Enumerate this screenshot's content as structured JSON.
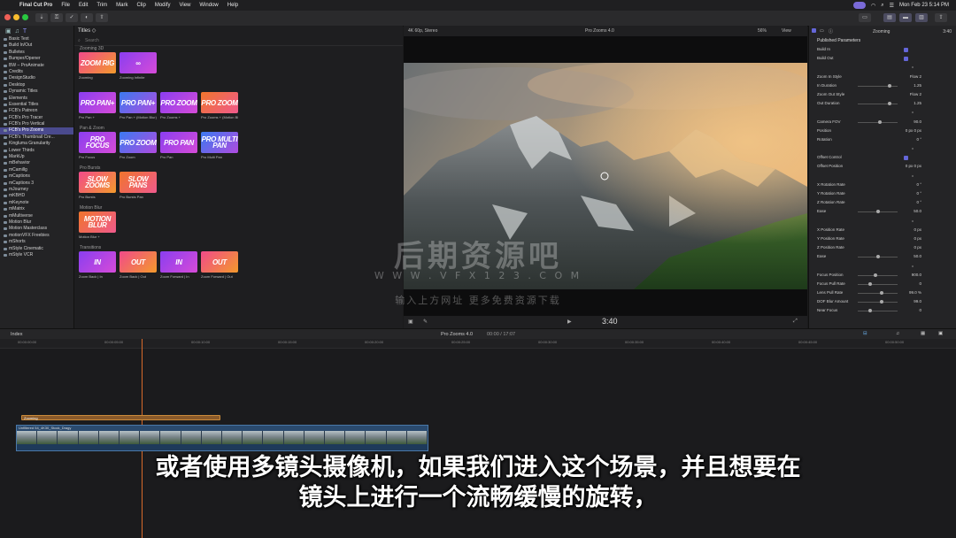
{
  "menubar": {
    "app": "Final Cut Pro",
    "items": [
      "File",
      "Edit",
      "Trim",
      "Mark",
      "Clip",
      "Modify",
      "View",
      "Window",
      "Help"
    ],
    "datetime": "Mon Feb 23  5:14 PM"
  },
  "sidebar": {
    "items": [
      {
        "label": "Basic Text"
      },
      {
        "label": "Build In/Out"
      },
      {
        "label": "Bulletes"
      },
      {
        "label": "Bumper/Opener"
      },
      {
        "label": "BW – ProAnimate"
      },
      {
        "label": "Credits"
      },
      {
        "label": "DesignStudio"
      },
      {
        "label": "Desktop"
      },
      {
        "label": "Dynamic Titles"
      },
      {
        "label": "Elements"
      },
      {
        "label": "Essential Titles"
      },
      {
        "label": "FCB's Patreon"
      },
      {
        "label": "FCB's Pro Tracer"
      },
      {
        "label": "FCB's Pro Vertical"
      },
      {
        "label": "FCB's Pro Zooms",
        "selected": true
      },
      {
        "label": "FCB's Thumbnail Cre..."
      },
      {
        "label": "Kingluma Granularity"
      },
      {
        "label": "Lower Thirds"
      },
      {
        "label": "MarkUp"
      },
      {
        "label": "mBehavior"
      },
      {
        "label": "mCamillg"
      },
      {
        "label": "mCaptions"
      },
      {
        "label": "mCaptions 3"
      },
      {
        "label": "mJourney"
      },
      {
        "label": "mKBHD"
      },
      {
        "label": "mKeynote"
      },
      {
        "label": "mMatrix"
      },
      {
        "label": "mMultiverse"
      },
      {
        "label": "Motion Blur"
      },
      {
        "label": "Motion Masterclass"
      },
      {
        "label": "motionVFX Freebies"
      },
      {
        "label": "mShorts"
      },
      {
        "label": "mStyle Cinematic"
      },
      {
        "label": "mStyle VCR"
      }
    ]
  },
  "browser": {
    "header": "Titles",
    "search_placeholder": "Search",
    "sections": [
      {
        "name": "Zooming 3D",
        "tiles": [
          {
            "art": "ZOOM RIG",
            "caption": "Zooming",
            "style": "g-or"
          },
          {
            "art": "∞",
            "caption": "Zooming Infinite",
            "style": "g-pu"
          }
        ]
      },
      {
        "name": "",
        "tiles": [
          {
            "art": "PRO PAN+",
            "caption": "Pro Pan +",
            "style": "g-pu"
          },
          {
            "art": "PRO PAN+",
            "caption": "Pro Pan + (Motion Blur)",
            "style": "g-bl"
          },
          {
            "art": "PRO ZOOM",
            "caption": "Pro Zooms +",
            "style": "g-pu"
          },
          {
            "art": "PRO ZOOM",
            "caption": "Pro Zooms + (Motion Blur)",
            "style": "g-or2"
          }
        ]
      },
      {
        "name": "Pan & Zoom",
        "tiles": [
          {
            "art": "PRO FOCUS",
            "caption": "Pro Focus",
            "style": "g-pu"
          },
          {
            "art": "PRO ZOOM",
            "caption": "Pro Zoom",
            "style": "g-bl"
          },
          {
            "art": "PRO PAN",
            "caption": "Pro Pan",
            "style": "g-pu"
          },
          {
            "art": "PRO MULTI PAN",
            "caption": "Pro Multi Pan",
            "style": "g-bl"
          }
        ]
      },
      {
        "name": "Pro Bursts",
        "tiles": [
          {
            "art": "SLOW ZOOMS",
            "caption": "Pro Bursts",
            "style": "g-or"
          },
          {
            "art": "SLOW PANS",
            "caption": "Pro Bursts Pan",
            "style": "g-or2"
          }
        ]
      },
      {
        "name": "Motion Blur",
        "tiles": [
          {
            "art": "MOTION BLUR",
            "caption": "Motion Blur +",
            "style": "g-or2"
          }
        ]
      },
      {
        "name": "Transitions",
        "tiles": [
          {
            "art": "IN",
            "caption": "Zoom Back | In",
            "style": "g-pu"
          },
          {
            "art": "OUT",
            "caption": "Zoom Back | Out",
            "style": "g-or"
          },
          {
            "art": "IN",
            "caption": "Zoom Forward | In",
            "style": "g-pu"
          },
          {
            "art": "OUT",
            "caption": "Zoom Forward | Out",
            "style": "g-or"
          }
        ]
      }
    ]
  },
  "viewer": {
    "format": "4K 60p, Stereo",
    "clip_name": "Pro Zooms 4.0",
    "zoom": "56%",
    "view_label": "View",
    "timecode": "3:40"
  },
  "inspector": {
    "title": "Zooming",
    "duration": "3:40",
    "section": "Published Parameters",
    "params": [
      {
        "label": "Build In",
        "type": "check"
      },
      {
        "label": "Build Out",
        "type": "check"
      },
      {
        "label": "",
        "type": "sep"
      },
      {
        "label": "Zoom In Style",
        "value": "Flow 2"
      },
      {
        "label": "In Duration",
        "value": "1.25",
        "slider": 0.8
      },
      {
        "label": "Zoom Out Style",
        "value": "Flow 2"
      },
      {
        "label": "Out Duration",
        "value": "1.25",
        "slider": 0.8
      },
      {
        "label": "",
        "type": "sep"
      },
      {
        "label": "Camera FOV",
        "value": "90.0",
        "slider": 0.55
      },
      {
        "label": "Position",
        "value": "0  px    0  px"
      },
      {
        "label": "Rotation",
        "value": "0 °"
      },
      {
        "label": "",
        "type": "sep"
      },
      {
        "label": "Offset Control",
        "type": "check"
      },
      {
        "label": "Offset Position",
        "value": "0  px    0  px"
      },
      {
        "label": "",
        "type": "sep"
      },
      {
        "label": "X Rotation Rate",
        "value": "0 °"
      },
      {
        "label": "Y Rotation Rate",
        "value": "0 °"
      },
      {
        "label": "Z Rotation Rate",
        "value": "0 °"
      },
      {
        "label": "Ease",
        "value": "50.0",
        "slider": 0.5
      },
      {
        "label": "",
        "type": "sep"
      },
      {
        "label": "X Position Rate",
        "value": "0  px"
      },
      {
        "label": "Y Position Rate",
        "value": "0  px"
      },
      {
        "label": "Z Position Rate",
        "value": "0  px"
      },
      {
        "label": "Ease",
        "value": "50.0",
        "slider": 0.5
      },
      {
        "label": "",
        "type": "sep"
      },
      {
        "label": "Focus Position",
        "value": "900.0",
        "slider": 0.45
      },
      {
        "label": "Focus Pull Rate",
        "value": "0",
        "slider": 0.3
      },
      {
        "label": "Lens Pull Rate",
        "value": "99.0  %",
        "slider": 0.6
      },
      {
        "label": "DOF Blur Amount",
        "value": "99.0",
        "slider": 0.6
      },
      {
        "label": "Near Focus",
        "value": "0",
        "slider": 0.3
      }
    ]
  },
  "timeline": {
    "index_label": "Index",
    "project_name": "Pro Zooms 4.0",
    "project_time": "00:00 / 17:07",
    "ruler": [
      "00:00:00:00",
      "00:00:05:00",
      "00:00:10:00",
      "00:00:15:00",
      "00:00:20:00",
      "00:00:25:00",
      "00:00:30:00",
      "00:00:35:00",
      "00:00:40:00",
      "00:00:45:00",
      "00:00:50:00",
      "00:00:55:00"
    ],
    "title_clip": "Zooming",
    "video_clip": "Unfiltered 54_4K30_Stock_Dragy"
  },
  "watermark": {
    "line1": "后期资源吧",
    "line2": "W W W . V F X 1 2 3 . C O M",
    "line3": "输入上方网址 更多免费资源下载"
  },
  "subtitle": {
    "line1": "或者使用多镜头摄像机，如果我们进入这个场景，并且想要在",
    "line2": "镜头上进行一个流畅缓慢的旋转，"
  },
  "colors": {
    "accent": "#6466d8",
    "playhead": "#d86a2a",
    "selection": "#4a4a8e"
  }
}
